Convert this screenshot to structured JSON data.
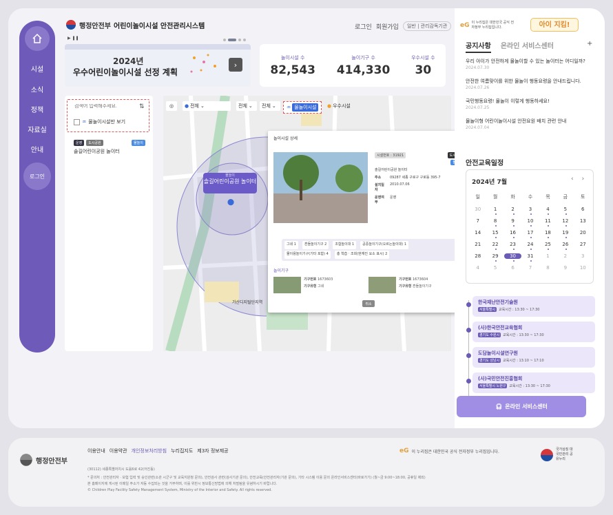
{
  "header": {
    "gov_name": "행정안전부",
    "system_name": "어린이놀이시설 안전관리시스템",
    "login": "로그인",
    "signup": "회원가입",
    "seg_a": "일반",
    "seg_b": "관리감독기관"
  },
  "sidebar": {
    "items": [
      {
        "label": "시설"
      },
      {
        "label": "소식"
      },
      {
        "label": "정책"
      },
      {
        "label": "자료실"
      },
      {
        "label": "안내"
      }
    ],
    "login": "로그인"
  },
  "banner": {
    "year": "2024년",
    "title": "우수어린이놀이시설 선정 계획"
  },
  "stats": [
    {
      "label": "놀이시설 수",
      "value": "82,543"
    },
    {
      "label": "놀이기구 수",
      "value": "414,330"
    },
    {
      "label": "우수시설 수",
      "value": "30"
    }
  ],
  "list": {
    "placeholder": "검색어 입력해주세요.",
    "checkbox_label": "물놀이시설만 보기",
    "badge1": "운영",
    "badge2": "도시공원",
    "tag": "물놀이",
    "item_name": "솔길어린이공원 놀이터"
  },
  "map": {
    "filter1": "전체",
    "filter2": "전체",
    "filter3": "전체",
    "tab1": "물놀이시설",
    "tab2": "우수시설",
    "pin_small": "물놀이",
    "pin_label": "솔길어린이공원 놀이터",
    "station": "가산디지털단지역"
  },
  "detail": {
    "title": "놀이시설 상세",
    "sub_badge": "시설번호 : 31921",
    "tag_a": "도시공원",
    "tag_b": "물놀이",
    "name": "솔길어린이공원 놀이터",
    "address_label": "주소",
    "address": "09287 세종 구로구 구로동 395-7",
    "install_label": "설치일자",
    "install": "2010.07.06",
    "op_label": "운영여부",
    "op": "운영",
    "chips": [
      "그네 1",
      "흔들놀이기구 2",
      "조합놀이대 1",
      "공중놀이기구(오르는놀이대) 1",
      "물이용놀이기구(기타 포함) 4",
      "총 학습 ‧ 조회(현재진 요소 표시) 2"
    ],
    "equip_title": "놀이기구",
    "eq1_no_label": "기구번호",
    "eq1_no": "1673603",
    "eq1_type_label": "기구유형",
    "eq1_type": "그네",
    "eq2_no_label": "기구번호",
    "eq2_no": "1673604",
    "eq2_type_label": "기구유형",
    "eq2_type": "흔들놀이기구",
    "cancel": "취소"
  },
  "right": {
    "logo_text": "이 누리집은 대한민국 공식 전자정부 누리집입니다.",
    "aiji": "아이 지킴!",
    "tab_on": "공지사항",
    "tab_off": "온라인 서비스센터",
    "plus": "+",
    "notices": [
      {
        "title": "우리 아이가 안전하게 물놀이할 수 있는 놀이터는 어디일까?",
        "date": "2024.07.30"
      },
      {
        "title": "안전한 여름맞이를 위한 물놀이 행동요령을 안내드립니다.",
        "date": "2024.07.26"
      },
      {
        "title": "국민행동요령! 물놀이 이렇게 행동하세요!",
        "date": "2024.07.25"
      },
      {
        "title": "물놀이형 어린이놀이시설 안전요원 배치 관련 안내",
        "date": "2024.07.04"
      }
    ],
    "cal_title": "안전교육일정",
    "cal_month": "2024년 7월",
    "weekdays": [
      "일",
      "월",
      "화",
      "수",
      "목",
      "금",
      "토"
    ],
    "events": [
      {
        "title": "한국재난안전기술원",
        "region": "서울특별시",
        "time": "교육시간 : 13:30 ~ 17:30"
      },
      {
        "title": "(사)한국안전교육협회",
        "region": "경기도 수원시",
        "time": "교육시간 : 13:30 ~ 17:30"
      },
      {
        "title": "도담놀이시설연구원",
        "region": "경기도 성남시",
        "time": "교육시간 : 13:10 ~ 17:10"
      },
      {
        "title": "(사)국민안전진흥협회",
        "region": "서울특별시 노원구",
        "time": "교육시간 : 13:30 ~ 17:30"
      }
    ],
    "online": "온라인 서비스센터"
  },
  "footer": {
    "gov": "행정안전부",
    "links": [
      "이용안내",
      "이용약관",
      "개인정보처리방침",
      "누리집지도",
      "제3자 정보제공"
    ],
    "addr": "(30112) 세종특별자치시 도움6로 42(어진동)",
    "note1": "* 문의처 : 안전관리자 · 보험 입력 및 승인관련(소관 시군구 및 교육지원청 문의), 안전검사 관련(검사기관 문의), 안전교육(안전관리자(기관 문의), 기타 시스템 이용 문의 온라인서비스센터(바로가기) (월~금 9:00~18:00, 공휴일 제외)",
    "note2": "본 홈페이지에 게시된 이메일 주소가 자동 수집되는 것을 거부하며, 이를 위반시 정보통신망법에 의해 처벌됨을 유념하시기 바랍니다.",
    "note3": "© Children Play Facility Safety Management System, Ministry of the Interior and Safety. All rights reserved.",
    "right": "이 누리집은 대한민국 공식 전자정부 누리집입니다.",
    "seal": "국가상징 대국민관리 공유누리"
  }
}
